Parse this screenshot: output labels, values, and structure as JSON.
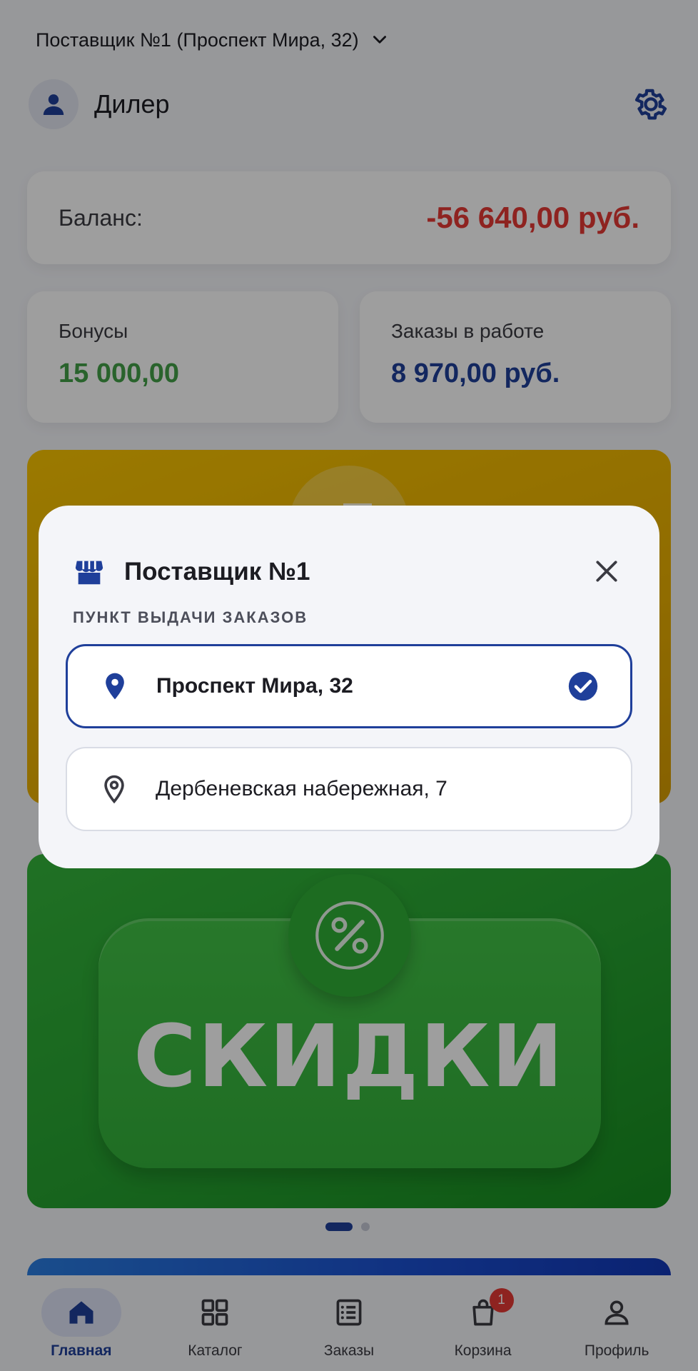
{
  "header": {
    "supplier_selector": "Поставщик №1 (Проспект Мира, 32)",
    "user_name": "Дилер"
  },
  "balance": {
    "label": "Баланс:",
    "value": "-56 640,00 руб.",
    "value_color": "#e53935"
  },
  "bonuses": {
    "label": "Бонусы",
    "value": "15 000,00",
    "value_color": "#43a047"
  },
  "orders_in_progress": {
    "label": "Заказы в работе",
    "value": "8 970,00 руб.",
    "value_color": "#1f3f9a"
  },
  "banners": {
    "active_index": 0,
    "total": 2,
    "promo_text": "СКИДКИ"
  },
  "bottom_nav": {
    "items": [
      {
        "label": "Главная",
        "icon": "home-icon",
        "active": true
      },
      {
        "label": "Каталог",
        "icon": "grid-icon",
        "active": false
      },
      {
        "label": "Заказы",
        "icon": "list-icon",
        "active": false
      },
      {
        "label": "Корзина",
        "icon": "bag-icon",
        "active": false,
        "badge": "1"
      },
      {
        "label": "Профиль",
        "icon": "user-icon",
        "active": false
      }
    ]
  },
  "modal": {
    "title": "Поставщик №1",
    "section_label": "ПУНКТ ВЫДАЧИ ЗАКАЗОВ",
    "options": [
      {
        "label": "Проспект Мира, 32",
        "selected": true
      },
      {
        "label": "Дербеневская набережная, 7",
        "selected": false
      }
    ]
  },
  "colors": {
    "accent": "#1f3f9a",
    "overlay": "rgba(0,0,0,0.38)",
    "promo_green": "#26a230",
    "promo_yellow": "#eab000"
  }
}
